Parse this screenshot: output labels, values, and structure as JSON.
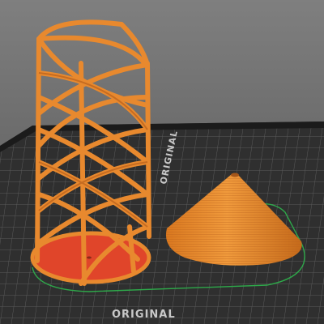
{
  "viewport": {
    "bed_label_top": "ORIGINAL",
    "bed_label_bottom": "ORIGINAL"
  },
  "colors": {
    "background": "#6e6e6e",
    "bed_surface": "#2f2f2f",
    "bed_grid": "#5a5a5a",
    "bed_edge": "#1b1b1b",
    "model_orange": "#e8892e",
    "model_orange_dark": "#b8601c",
    "first_layer_red": "#e0452a",
    "skirt_green": "#2ea84a"
  },
  "objects": [
    {
      "name": "twisted-lattice-vase"
    },
    {
      "name": "cone"
    }
  ]
}
